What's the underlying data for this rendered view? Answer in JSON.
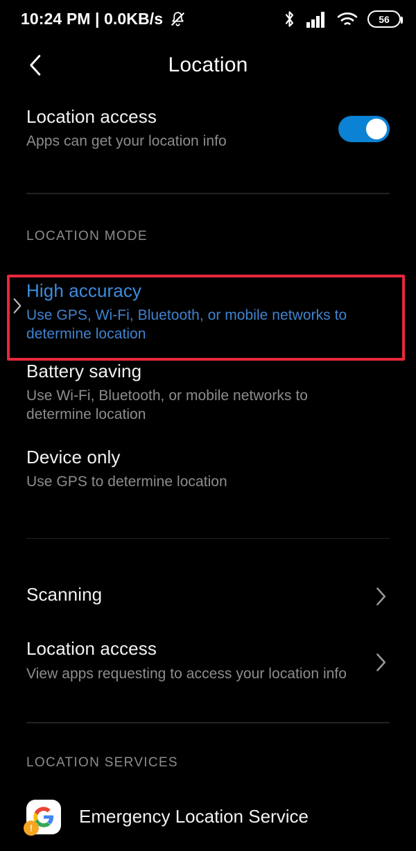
{
  "statusbar": {
    "clock": "10:24 PM | 0.0KB/s",
    "mute_icon": "bell-slash-icon",
    "bluetooth_icon": "bluetooth-icon",
    "signal_icon": "cellular-signal-icon",
    "wifi_icon": "wifi-icon",
    "battery_level": "56"
  },
  "header": {
    "back_icon": "back-chevron-icon",
    "title": "Location"
  },
  "master": {
    "title": "Location access",
    "subtitle": "Apps can get your location info",
    "toggle_on": true,
    "toggle_color": "#0b82d4"
  },
  "location_mode": {
    "section_label": "LOCATION MODE",
    "options": [
      {
        "title": "High accuracy",
        "subtitle": "Use GPS, Wi-Fi, Bluetooth, or mobile networks to determine location",
        "selected": true
      },
      {
        "title": "Battery saving",
        "subtitle": "Use Wi-Fi, Bluetooth, or mobile networks to determine location",
        "selected": false
      },
      {
        "title": "Device only",
        "subtitle": "Use GPS to determine location",
        "selected": false
      }
    ]
  },
  "links": [
    {
      "title": "Scanning",
      "subtitle": ""
    },
    {
      "title": "Location access",
      "subtitle": "View apps requesting to access your location info"
    }
  ],
  "location_services": {
    "section_label": "LOCATION SERVICES",
    "items": [
      {
        "title": "Emergency Location Service",
        "icon": "google-g-icon"
      }
    ]
  },
  "annotation": {
    "color": "#e8283c",
    "target": "High accuracy"
  }
}
